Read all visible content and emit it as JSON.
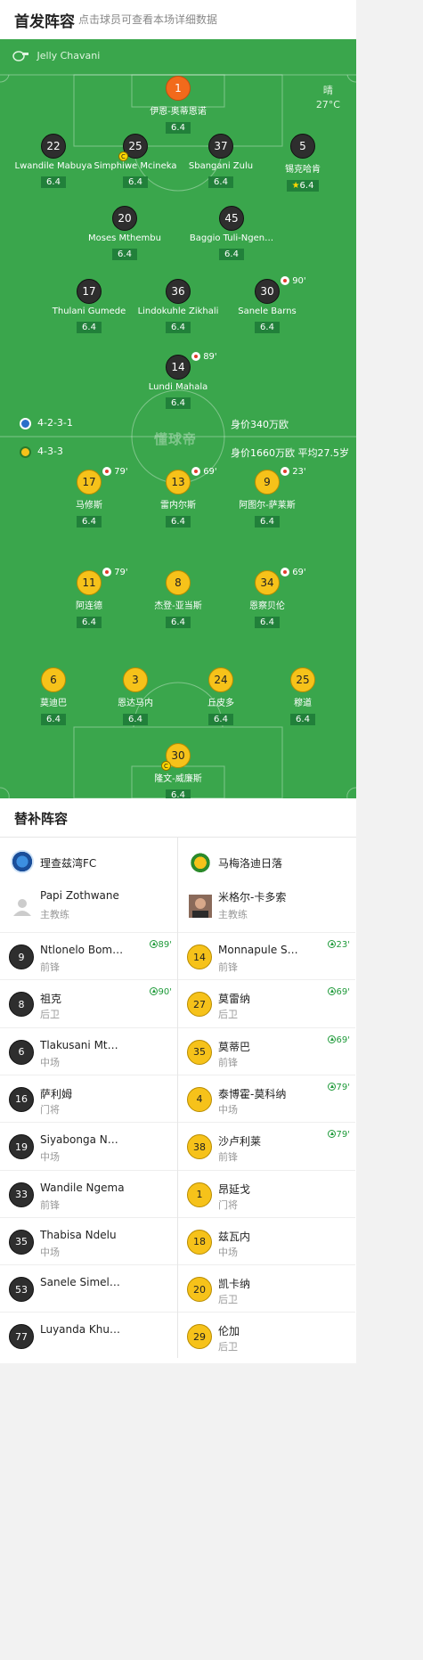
{
  "header": {
    "title": "首发阵容",
    "hint": "点击球员可查看本场详细数据"
  },
  "pitch": {
    "referee": "Jelly Chavani",
    "weather": {
      "condition": "晴",
      "temp": "27°C"
    },
    "watermark": "懂球帝",
    "home_formation": "4-2-3-1",
    "home_value": "身价340万欧",
    "away_formation": "4-3-3",
    "away_value": "身价1660万欧 平均27.5岁",
    "home_players": [
      {
        "num": "1",
        "name": "伊恩-奥蒂恩诺",
        "rating": "6.4"
      },
      {
        "num": "22",
        "name": "Lwandile Mabuya",
        "rating": "6.4"
      },
      {
        "num": "25",
        "name": "Simphiwe Mcineka",
        "rating": "6.4",
        "captain": "C"
      },
      {
        "num": "37",
        "name": "Sbangani Zulu",
        "rating": "6.4"
      },
      {
        "num": "5",
        "name": "锡克哈肯",
        "rating": "6.4",
        "star": "★"
      },
      {
        "num": "20",
        "name": "Moses Mthembu",
        "rating": "6.4"
      },
      {
        "num": "45",
        "name": "Baggio Tuli-Ngen…",
        "rating": "6.4"
      },
      {
        "num": "17",
        "name": "Thulani Gumede",
        "rating": "6.4"
      },
      {
        "num": "36",
        "name": "Lindokuhle Zikhali",
        "rating": "6.4"
      },
      {
        "num": "30",
        "name": "Sanele Barns",
        "rating": "6.4",
        "sub": "90'"
      },
      {
        "num": "14",
        "name": "Lundi Mahala",
        "rating": "6.4",
        "sub": "89'"
      }
    ],
    "away_players": [
      {
        "num": "17",
        "name": "马修斯",
        "rating": "6.4",
        "sub": "79'"
      },
      {
        "num": "13",
        "name": "雷内尔斯",
        "rating": "6.4",
        "sub": "69'"
      },
      {
        "num": "9",
        "name": "阿图尔-萨莱斯",
        "rating": "6.4",
        "sub": "23'"
      },
      {
        "num": "11",
        "name": "阿连德",
        "rating": "6.4",
        "sub": "79'"
      },
      {
        "num": "8",
        "name": "杰登-亚当斯",
        "rating": "6.4"
      },
      {
        "num": "34",
        "name": "恩察贝伦",
        "rating": "6.4",
        "sub": "69'"
      },
      {
        "num": "6",
        "name": "莫迪巴",
        "rating": "6.4"
      },
      {
        "num": "3",
        "name": "恩达马内",
        "rating": "6.4"
      },
      {
        "num": "24",
        "name": "丘皮多",
        "rating": "6.4"
      },
      {
        "num": "25",
        "name": "穆道",
        "rating": "6.4"
      },
      {
        "num": "30",
        "name": "隆文-威廉斯",
        "rating": "6.4",
        "captain": "C"
      }
    ]
  },
  "subs": {
    "title": "替补阵容",
    "home": {
      "team": "理查兹湾FC",
      "coach": {
        "name": "Papi Zothwane",
        "role": "主教练"
      },
      "players": [
        {
          "num": "9",
          "name": "Ntlonelo Bom…",
          "pos": "前锋",
          "time": "89'"
        },
        {
          "num": "8",
          "name": "祖克",
          "pos": "后卫",
          "time": "90'"
        },
        {
          "num": "6",
          "name": "Tlakusani Mt…",
          "pos": "中场"
        },
        {
          "num": "16",
          "name": "萨利姆",
          "pos": "门将"
        },
        {
          "num": "19",
          "name": "Siyabonga N…",
          "pos": "中场"
        },
        {
          "num": "33",
          "name": "Wandile Ngema",
          "pos": "前锋"
        },
        {
          "num": "35",
          "name": "Thabisa Ndelu",
          "pos": "中场"
        },
        {
          "num": "53",
          "name": "Sanele Simel…",
          "pos": ""
        },
        {
          "num": "77",
          "name": "Luyanda Khu…",
          "pos": ""
        }
      ]
    },
    "away": {
      "team": "马梅洛迪日落",
      "coach": {
        "name": "米格尔-卡多索",
        "role": "主教练"
      },
      "players": [
        {
          "num": "14",
          "name": "Monnapule S…",
          "pos": "前锋",
          "time": "23'"
        },
        {
          "num": "27",
          "name": "莫雷纳",
          "pos": "后卫",
          "time": "69'"
        },
        {
          "num": "35",
          "name": "莫蒂巴",
          "pos": "前锋",
          "time": "69'"
        },
        {
          "num": "4",
          "name": "泰博霍-莫科纳",
          "pos": "中场",
          "time": "79'"
        },
        {
          "num": "38",
          "name": "沙卢利莱",
          "pos": "前锋",
          "time": "79'"
        },
        {
          "num": "1",
          "name": "昂延戈",
          "pos": "门将"
        },
        {
          "num": "18",
          "name": "兹瓦内",
          "pos": "中场"
        },
        {
          "num": "20",
          "name": "凯卡纳",
          "pos": "后卫"
        },
        {
          "num": "29",
          "name": "伦加",
          "pos": "后卫"
        }
      ]
    }
  },
  "colors": {
    "pitch": "#3aa64c",
    "home_circle": "#2e2e2e",
    "away_circle": "#f6c21a",
    "gk_circle": "#f26a1b",
    "sub_green": "#1f9a3a"
  }
}
